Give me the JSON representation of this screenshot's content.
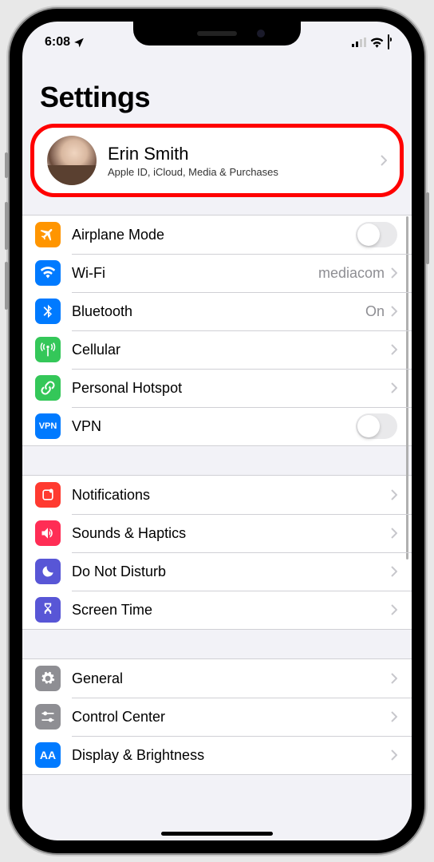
{
  "status_bar": {
    "time": "6:08",
    "location_on": true
  },
  "page": {
    "title": "Settings"
  },
  "profile": {
    "name": "Erin Smith",
    "subtitle": "Apple ID, iCloud, Media & Purchases"
  },
  "sections": [
    {
      "rows": [
        {
          "id": "airplane",
          "label": "Airplane Mode",
          "icon": "airplane-icon",
          "color": "#ff9500",
          "type": "toggle",
          "value": false
        },
        {
          "id": "wifi",
          "label": "Wi-Fi",
          "icon": "wifi-icon",
          "color": "#007aff",
          "type": "link",
          "detail": "mediacom"
        },
        {
          "id": "bluetooth",
          "label": "Bluetooth",
          "icon": "bluetooth-icon",
          "color": "#007aff",
          "type": "link",
          "detail": "On"
        },
        {
          "id": "cellular",
          "label": "Cellular",
          "icon": "antenna-icon",
          "color": "#34c759",
          "type": "link"
        },
        {
          "id": "hotspot",
          "label": "Personal Hotspot",
          "icon": "link-icon",
          "color": "#34c759",
          "type": "link"
        },
        {
          "id": "vpn",
          "label": "VPN",
          "icon": "vpn-icon",
          "color": "#007aff",
          "type": "toggle",
          "value": false
        }
      ]
    },
    {
      "rows": [
        {
          "id": "notifications",
          "label": "Notifications",
          "icon": "bell-icon",
          "color": "#ff3a30",
          "type": "link"
        },
        {
          "id": "sounds",
          "label": "Sounds & Haptics",
          "icon": "speaker-icon",
          "color": "#ff2d55",
          "type": "link"
        },
        {
          "id": "dnd",
          "label": "Do Not Disturb",
          "icon": "moon-icon",
          "color": "#5856d6",
          "type": "link"
        },
        {
          "id": "screentime",
          "label": "Screen Time",
          "icon": "hourglass-icon",
          "color": "#5856d6",
          "type": "link"
        }
      ]
    },
    {
      "rows": [
        {
          "id": "general",
          "label": "General",
          "icon": "gear-icon",
          "color": "#8e8e93",
          "type": "link"
        },
        {
          "id": "controlcenter",
          "label": "Control Center",
          "icon": "sliders-icon",
          "color": "#8e8e93",
          "type": "link"
        },
        {
          "id": "display",
          "label": "Display & Brightness",
          "icon": "text-aa-icon",
          "color": "#007aff",
          "type": "link"
        }
      ]
    }
  ]
}
